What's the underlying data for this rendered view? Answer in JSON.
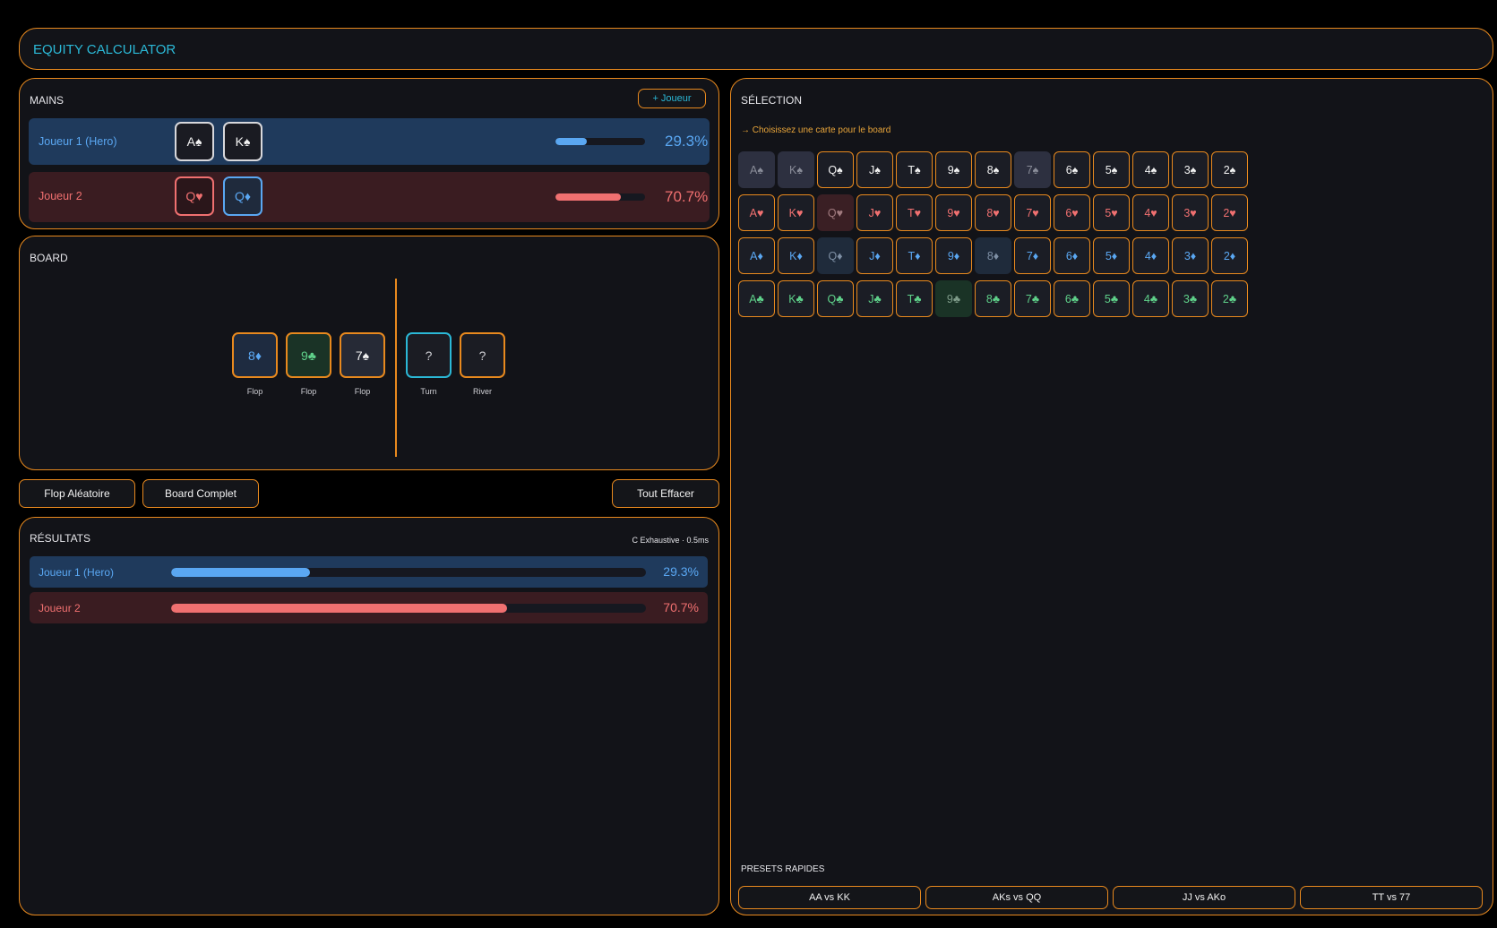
{
  "app": {
    "title": "EQUITY CALCULATOR"
  },
  "mains": {
    "title": "MAINS",
    "add_player": "+ Joueur",
    "players": [
      {
        "name": "Joueur 1 (Hero)",
        "cards": [
          "A♠",
          "K♠"
        ],
        "card_suits": [
          "spade",
          "spade"
        ],
        "equity_label": "29.3%",
        "equity": 29.3
      },
      {
        "name": "Joueur 2",
        "cards": [
          "Q♥",
          "Q♦"
        ],
        "card_suits": [
          "heart",
          "diamond"
        ],
        "equity_label": "70.7%",
        "equity": 70.7
      }
    ]
  },
  "board": {
    "title": "BOARD",
    "cards": [
      {
        "label": "8♦",
        "suit": "diamond",
        "street": "Flop"
      },
      {
        "label": "9♣",
        "suit": "club",
        "street": "Flop"
      },
      {
        "label": "7♠",
        "suit": "spade",
        "street": "Flop"
      },
      {
        "label": "?",
        "suit": "empty",
        "street": "Turn",
        "active": true
      },
      {
        "label": "?",
        "suit": "empty",
        "street": "River"
      }
    ]
  },
  "actions": {
    "random_flop": "Flop Aléatoire",
    "full_board": "Board Complet",
    "clear_all": "Tout Effacer"
  },
  "results": {
    "title": "RÉSULTATS",
    "info": "C Exhaustive · 0.5ms",
    "rows": [
      {
        "name": "Joueur 1 (Hero)",
        "equity_label": "29.3%",
        "equity": 29.3
      },
      {
        "name": "Joueur 2",
        "equity_label": "70.7%",
        "equity": 70.7
      }
    ]
  },
  "selection": {
    "title": "SÉLECTION",
    "hint": "→ Choisissez une carte pour le board",
    "ranks": [
      "A",
      "K",
      "Q",
      "J",
      "T",
      "9",
      "8",
      "7",
      "6",
      "5",
      "4",
      "3",
      "2"
    ],
    "suits": [
      {
        "name": "spade",
        "symbol": "♠"
      },
      {
        "name": "heart",
        "symbol": "♥"
      },
      {
        "name": "diamond",
        "symbol": "♦"
      },
      {
        "name": "club",
        "symbol": "♣"
      }
    ],
    "used_cards": [
      "A♠",
      "K♠",
      "7♠",
      "Q♥",
      "Q♦",
      "8♦",
      "9♣"
    ]
  },
  "presets": {
    "title": "PRESETS RAPIDES",
    "items": [
      "AA vs KK",
      "AKs vs QQ",
      "JJ vs AKo",
      "TT vs 77"
    ]
  },
  "colors": {
    "accent": "#e8891e",
    "title": "#2bb8d6",
    "hero": "#5aa7f2",
    "villain": "#f07070",
    "club": "#5fd18a"
  }
}
